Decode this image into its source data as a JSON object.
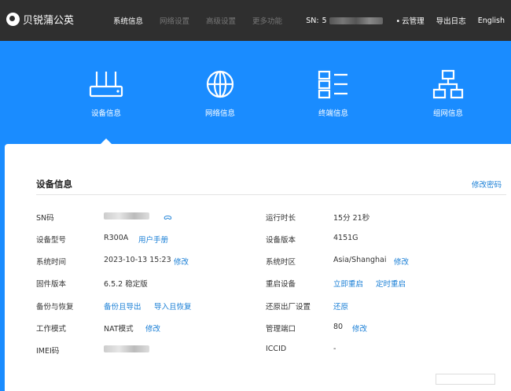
{
  "brand": {
    "name": "贝锐蒲公英"
  },
  "nav": [
    {
      "label": "系统信息",
      "active": true
    },
    {
      "label": "网络设置",
      "active": false
    },
    {
      "label": "高级设置",
      "active": false
    },
    {
      "label": "更多功能",
      "active": false
    }
  ],
  "top_right": {
    "sn_label": "SN:",
    "sn_value_prefix": "5",
    "cloud": "云管理",
    "export": "导出日志",
    "language": "English"
  },
  "categories": [
    {
      "label": "设备信息",
      "icon": "router-icon"
    },
    {
      "label": "网络信息",
      "icon": "globe-icon"
    },
    {
      "label": "终端信息",
      "icon": "list-icon"
    },
    {
      "label": "组网信息",
      "icon": "topology-icon"
    }
  ],
  "panel": {
    "title": "设备信息",
    "modify_password": "修改密码"
  },
  "left_fields": [
    {
      "label": "SN码",
      "value": "",
      "links": []
    },
    {
      "label": "设备型号",
      "value": "R300A",
      "links": [
        "用户手册"
      ]
    },
    {
      "label": "系统时间",
      "value": "2023-10-13 15:23",
      "links": [
        "修改"
      ]
    },
    {
      "label": "固件版本",
      "value": "6.5.2 稳定版",
      "links": []
    },
    {
      "label": "备份与恢复",
      "value": "",
      "links": [
        "备份且导出",
        "导入且恢复"
      ]
    },
    {
      "label": "工作模式",
      "value": "NAT模式",
      "links": [
        "修改"
      ]
    },
    {
      "label": "IMEI码",
      "value": "",
      "links": []
    }
  ],
  "right_fields": [
    {
      "label": "运行时长",
      "value": "15分 21秒",
      "links": []
    },
    {
      "label": "设备版本",
      "value": "4151G",
      "links": []
    },
    {
      "label": "系统时区",
      "value": "Asia/Shanghai",
      "links": [
        "修改"
      ]
    },
    {
      "label": "重启设备",
      "value": "",
      "links": [
        "立即重启",
        "定时重启"
      ]
    },
    {
      "label": "还原出厂设置",
      "value": "",
      "links": [
        "还原"
      ]
    },
    {
      "label": "管理端口",
      "value": "80",
      "links": [
        "修改"
      ]
    },
    {
      "label": "ICCID",
      "value": "-",
      "links": []
    }
  ],
  "colors": {
    "accent": "#1a8cff",
    "link": "#1a7fd6",
    "topbar": "#2f2f2f"
  }
}
